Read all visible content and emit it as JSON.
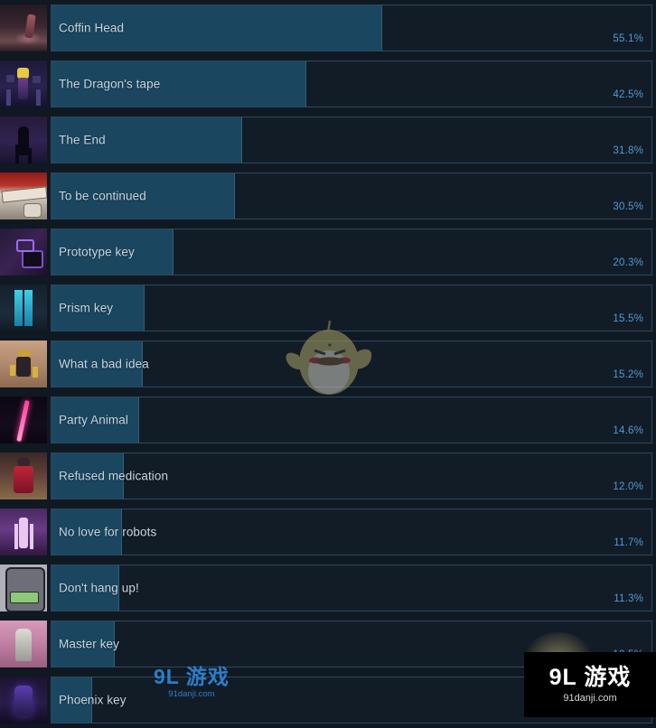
{
  "page": {
    "background_color": "#101822",
    "bar_fill_color": "#1b4660",
    "bar_border_color": "#2f5f7d",
    "track_border_color": "#2b4a5e",
    "name_text_color": "#c9d6e2",
    "percent_text_color": "#4e9ad4"
  },
  "chart_data": {
    "type": "bar",
    "title": "",
    "xlabel": "",
    "ylabel": "",
    "orientation": "horizontal",
    "xlim": [
      0,
      100
    ],
    "unit": "%",
    "grid": false,
    "legend": "none",
    "categories": [
      "Coffin Head",
      "The Dragon's tape",
      "The End",
      "To be continued",
      "Prototype key",
      "Prism key",
      "What a bad idea",
      "Party Animal",
      "Refused medication",
      "No love for robots",
      "Don't hang up!",
      "Master key",
      "Phoenix key"
    ],
    "values": [
      55.1,
      42.5,
      31.8,
      30.5,
      20.3,
      15.5,
      15.2,
      14.6,
      12.0,
      11.7,
      11.3,
      10.5,
      6.8
    ],
    "value_labels": [
      "55.1%",
      "42.5%",
      "31.8%",
      "30.5%",
      "20.3%",
      "15.5%",
      "15.2%",
      "14.6%",
      "12.0%",
      "11.7%",
      "11.3%",
      "10.5%",
      ""
    ]
  },
  "achievements": [
    {
      "name": "Coffin Head",
      "percent_label": "55.1%",
      "percent": 55.1,
      "art": "art-coffin",
      "icon": "coffin-head-thumbnail"
    },
    {
      "name": "The Dragon's tape",
      "percent_label": "42.5%",
      "percent": 42.5,
      "art": "art-dragon",
      "icon": "dragons-tape-thumbnail"
    },
    {
      "name": "The End",
      "percent_label": "31.8%",
      "percent": 31.8,
      "art": "art-end",
      "icon": "the-end-thumbnail"
    },
    {
      "name": "To be continued",
      "percent_label": "30.5%",
      "percent": 30.5,
      "art": "art-continued",
      "icon": "to-be-continued-thumbnail"
    },
    {
      "name": "Prototype key",
      "percent_label": "20.3%",
      "percent": 20.3,
      "art": "art-prototype",
      "icon": "prototype-key-thumbnail"
    },
    {
      "name": "Prism key",
      "percent_label": "15.5%",
      "percent": 15.5,
      "art": "art-prism",
      "icon": "prism-key-thumbnail"
    },
    {
      "name": "What a bad idea",
      "percent_label": "15.2%",
      "percent": 15.2,
      "art": "art-badidea",
      "icon": "what-a-bad-idea-thumbnail"
    },
    {
      "name": "Party Animal",
      "percent_label": "14.6%",
      "percent": 14.6,
      "art": "art-party",
      "icon": "party-animal-thumbnail"
    },
    {
      "name": "Refused medication",
      "percent_label": "12.0%",
      "percent": 12.0,
      "art": "art-refused",
      "icon": "refused-medication-thumbnail"
    },
    {
      "name": "No love for robots",
      "percent_label": "11.7%",
      "percent": 11.7,
      "art": "art-robots",
      "icon": "no-love-for-robots-thumbnail"
    },
    {
      "name": "Don't hang up!",
      "percent_label": "11.3%",
      "percent": 11.3,
      "art": "art-phone",
      "icon": "dont-hang-up-thumbnail"
    },
    {
      "name": "Master key",
      "percent_label": "10.5%",
      "percent": 10.5,
      "art": "art-master",
      "icon": "master-key-thumbnail"
    },
    {
      "name": "Phoenix key",
      "percent_label": "",
      "percent": 6.8,
      "art": "art-phoenix",
      "icon": "phoenix-key-thumbnail"
    }
  ],
  "watermarks": {
    "corner": {
      "main": "9L 游戏",
      "sub": "91danji.com"
    },
    "middle": {
      "main": "9L 游戏",
      "sub": "91danji.com"
    },
    "mascot": "bird-mascot-watermark"
  }
}
